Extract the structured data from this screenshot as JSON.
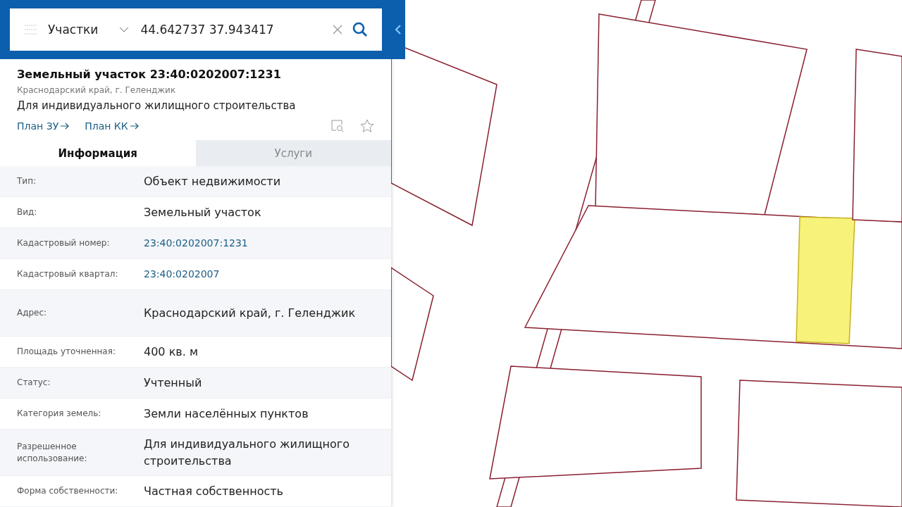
{
  "search": {
    "layer": "Участки",
    "value": "44.642737 37.943417"
  },
  "parcel": {
    "title": "Земельный участок 23:40:0202007:1231",
    "region": "Краснодарский край, г. Геленджик",
    "purpose": "Для индивидуального жилищного строительства",
    "links": [
      "План ЗУ",
      "План КК"
    ]
  },
  "tabs": [
    {
      "label": "Информация",
      "selected": true
    },
    {
      "label": "Услуги",
      "selected": false
    }
  ],
  "rows": [
    {
      "label": "Тип:",
      "value": "Объект недвижимости",
      "kind": "text"
    },
    {
      "label": "Вид:",
      "value": "Земельный участок",
      "kind": "text"
    },
    {
      "label": "Кадастровый номер:",
      "value": "23:40:0202007:1231",
      "kind": "link"
    },
    {
      "label": "Кадастровый квартал:",
      "value": "23:40:0202007",
      "kind": "link"
    },
    {
      "label": "Адрес:",
      "value": "Краснодарский край, г. Геленджик",
      "kind": "text"
    },
    {
      "label": "Площадь уточненная:",
      "value": "400 кв. м",
      "kind": "text"
    },
    {
      "label": "Статус:",
      "value": "Учтенный",
      "kind": "text"
    },
    {
      "label": "Категория земель:",
      "value": "Земли населённых пунктов",
      "kind": "text"
    },
    {
      "label": "Разрешенное использование:",
      "value": "Для индивидуального жилищного строительства",
      "kind": "text"
    },
    {
      "label": "Форма собственности:",
      "value": "Частная собственность",
      "kind": "text"
    }
  ]
}
